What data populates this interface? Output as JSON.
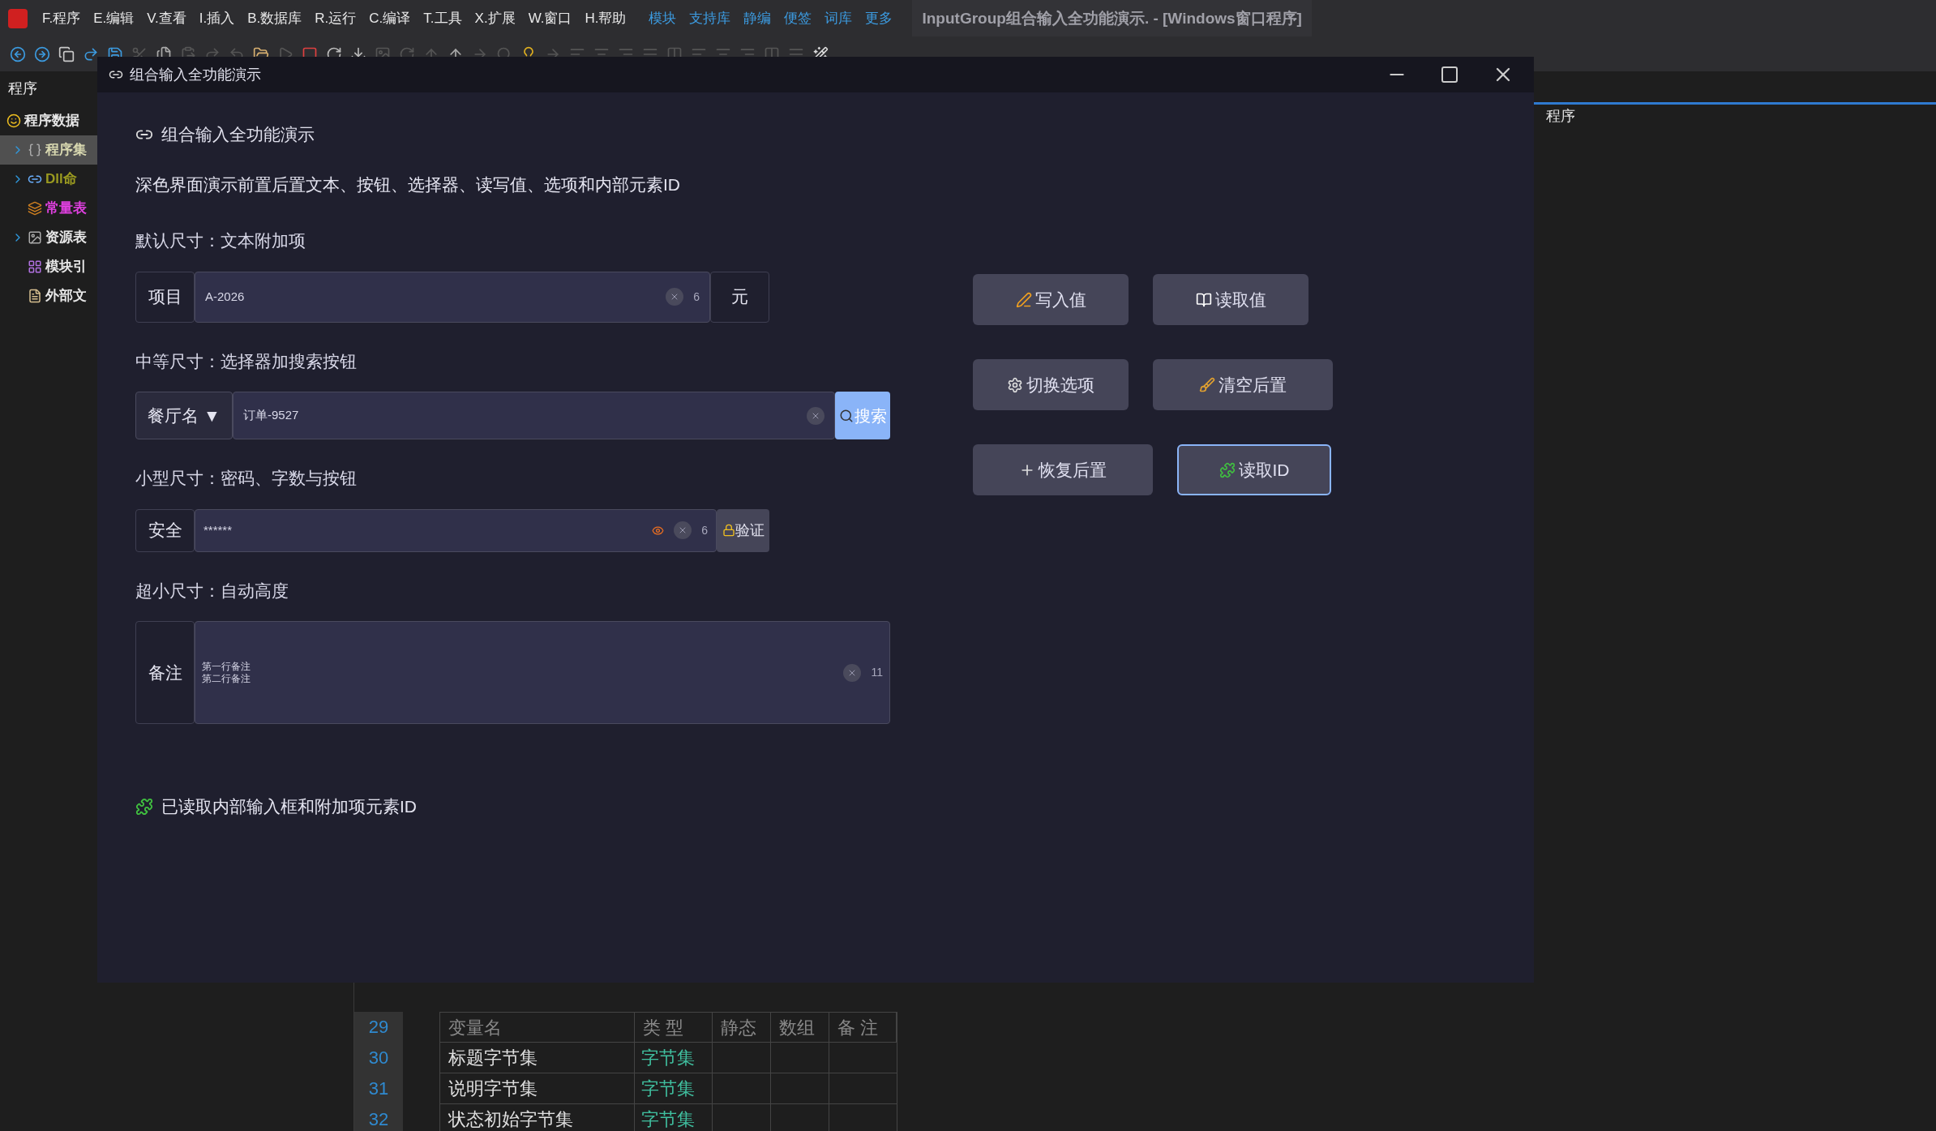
{
  "app": {
    "menu": [
      "F.程序",
      "E.编辑",
      "V.查看",
      "I.插入",
      "B.数据库",
      "R.运行",
      "C.编译",
      "T.工具",
      "X.扩展",
      "W.窗口",
      "H.帮助"
    ],
    "quick_links": [
      "模块",
      "支持库",
      "静编",
      "便签",
      "词库",
      "更多"
    ],
    "title": "InputGroup组合输入全功能演示. - [Windows窗口程序]"
  },
  "sidebar": {
    "header": "程序",
    "items": [
      {
        "label": "程序数据",
        "selected": false,
        "color": "#e8e8e8",
        "children": [
          {
            "label": "程序集",
            "expandable": true,
            "selected": true,
            "color": "#d8d8b0"
          },
          {
            "label": "Dll命",
            "expandable": true,
            "selected": false,
            "color": "#9a9a20"
          },
          {
            "label": "常量表",
            "expandable": false,
            "selected": false,
            "color": "#e040e0"
          },
          {
            "label": "资源表",
            "expandable": true,
            "selected": false,
            "color": "#e8e8e8"
          },
          {
            "label": "模块引",
            "expandable": false,
            "selected": false,
            "color": "#e8e8e8"
          },
          {
            "label": "外部文",
            "expandable": false,
            "selected": false,
            "color": "#e8e8e8"
          }
        ]
      }
    ]
  },
  "right_panel": {
    "tab": "程序"
  },
  "editor": {
    "line_numbers": [
      "29",
      "30",
      "31",
      "32"
    ],
    "table": {
      "columns": [
        "变量名",
        "类 型",
        "静态",
        "数组",
        "备 注"
      ],
      "rows": [
        {
          "name": "标题字节集",
          "type": "字节集"
        },
        {
          "name": "说明字节集",
          "type": "字节集"
        },
        {
          "name": "状态初始字节集",
          "type": "字节集"
        }
      ]
    }
  },
  "dialog": {
    "title": "组合输入全功能演示",
    "heading": "组合输入全功能演示",
    "description": "深色界面演示前置后置文本、按钮、选择器、读写值、选项和内部元素ID",
    "sections": [
      {
        "kind": "text-addon",
        "label": "默认尺寸：文本附加项",
        "prefix": "项目",
        "value": "A-2026",
        "count": "6",
        "suffix": "元"
      },
      {
        "kind": "select-search",
        "label": "中等尺寸：选择器加搜索按钮",
        "select": "餐厅名 ▼",
        "value": "订单-9527",
        "button": "搜索"
      },
      {
        "kind": "password",
        "label": "小型尺寸：密码、字数与按钮",
        "prefix": "安全",
        "value": "******",
        "count": "6",
        "button": "验证"
      },
      {
        "kind": "textarea",
        "label": "超小尺寸：自动高度",
        "prefix": "备注",
        "lines": [
          "第一行备注",
          "第二行备注"
        ],
        "count": "11"
      }
    ],
    "buttons": [
      {
        "label": "写入值",
        "kind": "write",
        "focused": false
      },
      {
        "label": "读取值",
        "kind": "read",
        "focused": false
      },
      {
        "label": "切换选项",
        "kind": "toggle",
        "focused": false
      },
      {
        "label": "清空后置",
        "kind": "clear",
        "focused": false
      },
      {
        "label": "恢复后置",
        "kind": "restore",
        "focused": false
      },
      {
        "label": "读取ID",
        "kind": "id",
        "focused": true
      }
    ],
    "status": "已读取内部输入框和附加项元素ID"
  }
}
